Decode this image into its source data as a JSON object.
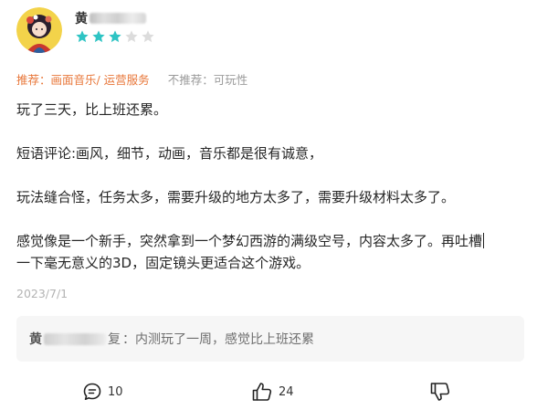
{
  "user": {
    "name_visible_char": "黄",
    "rating": 3,
    "rating_max": 5,
    "star_color_on": "#2ec4c4",
    "star_color_off": "#dcdcdc"
  },
  "tags": {
    "recommend": "推荐：画面音乐/ 运营服务",
    "not_recommend": "不推荐：可玩性"
  },
  "review": {
    "line1": "玩了三天，比上班还累。",
    "line2": "短语评论:画风，细节，动画，音乐都是很有诚意，",
    "line3": "玩法缝合怪，任务太多，需要升级的地方太多了，需要升级材料太多了。",
    "line4a": "感觉像是一个新手，突然拿到一个梦幻西游的满级空号，内容太多了。再吐槽",
    "line4b": "一下毫无意义的3D，固定镜头更适合这个游戏。"
  },
  "date": "2023/7/1",
  "reply": {
    "name_visible_char": "黄",
    "suffix": "复",
    "text": "：内测玩了一周，感觉比上班还累"
  },
  "actions": {
    "comment_count": "10",
    "like_count": "24"
  },
  "colors": {
    "accent_orange": "#e8773a",
    "muted_gray": "#9a9a9a"
  }
}
